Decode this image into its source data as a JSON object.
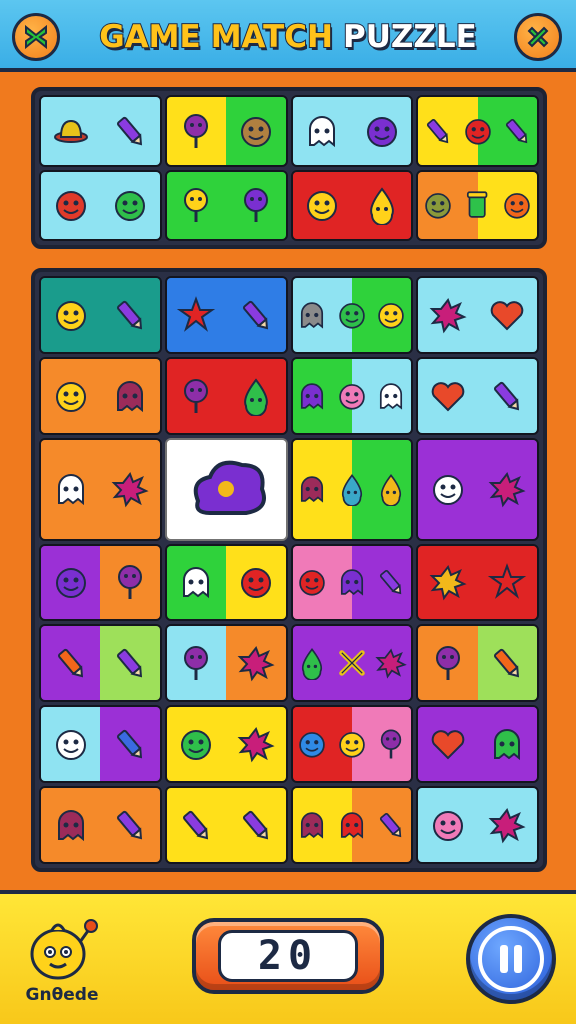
{
  "header": {
    "title_parts": [
      "GAME",
      "MATCH",
      "PUZZLE"
    ],
    "left_icon": "crossed-swords-icon",
    "right_icon": "tools-icon"
  },
  "colors": {
    "orange": "#f58a2a",
    "green": "#2fd23b",
    "blue": "#2f7de6",
    "cyan": "#8fe3f2",
    "yellow": "#ffe01a",
    "red": "#e02424",
    "purple": "#9b30d6",
    "pink": "#f07ab8",
    "lime": "#9ee05a",
    "teal": "#1a9c8c",
    "lightgreen": "#6fe05c",
    "white": "#ffffff"
  },
  "top_board": [
    {
      "bg": [
        "cyan",
        "cyan"
      ],
      "icons": [
        "hat-icon",
        "crayon-icon"
      ]
    },
    {
      "bg": [
        "yellow",
        "green"
      ],
      "icons": [
        "lollipop-icon",
        "potato-monster-icon"
      ]
    },
    {
      "bg": [
        "cyan",
        "cyan"
      ],
      "icons": [
        "ghost-blob-icon",
        "purple-blob-icon"
      ]
    },
    {
      "bg": [
        "yellow",
        "green"
      ],
      "icons": [
        "crayon-icon",
        "apple-icon",
        "crayon-icon"
      ]
    },
    {
      "bg": [
        "cyan",
        "cyan"
      ],
      "icons": [
        "ball-icon",
        "green-blob-icon"
      ]
    },
    {
      "bg": [
        "green",
        "green"
      ],
      "icons": [
        "yellow-lollipop-icon",
        "purple-lollipop-icon"
      ]
    },
    {
      "bg": [
        "red",
        "red"
      ],
      "icons": [
        "yellow-blob-icon",
        "yellow-drop-icon"
      ]
    },
    {
      "bg": [
        "orange",
        "yellow"
      ],
      "icons": [
        "olive-blob-icon",
        "cup-icon",
        "orange-blob-icon"
      ]
    }
  ],
  "main_board": [
    {
      "bg": [
        "teal",
        "teal"
      ],
      "icons": [
        "smile-icon",
        "crayon-icon"
      ]
    },
    {
      "bg": [
        "blue",
        "blue"
      ],
      "icons": [
        "star-icon",
        "crayon-icon"
      ]
    },
    {
      "bg": [
        "cyan",
        "green"
      ],
      "icons": [
        "bell-monster-icon",
        "eye-monster-icon",
        "smile-icon"
      ]
    },
    {
      "bg": [
        "cyan",
        "cyan"
      ],
      "icons": [
        "splat-icon",
        "heart-icon"
      ]
    },
    {
      "bg": [
        "orange",
        "orange"
      ],
      "icons": [
        "smile-icon",
        "robot-icon"
      ]
    },
    {
      "bg": [
        "red",
        "red"
      ],
      "icons": [
        "lollipop-icon",
        "drop-icon"
      ]
    },
    {
      "bg": [
        "green",
        "cyan"
      ],
      "icons": [
        "purple-ghost-icon",
        "pink-blob-icon",
        "ghost-icon"
      ]
    },
    {
      "bg": [
        "cyan",
        "cyan"
      ],
      "icons": [
        "heart-lollipop-icon",
        "crayon-icon"
      ]
    },
    {
      "bg": [
        "orange",
        "orange"
      ],
      "icons": [
        "doll-icon",
        "splat-icon"
      ]
    },
    {
      "bg": [
        "white",
        "white"
      ],
      "icons": [
        "cloud-blob-icon"
      ]
    },
    {
      "bg": [
        "yellow",
        "green"
      ],
      "icons": [
        "bell-robot-icon",
        "squid-icon",
        "seahorse-icon"
      ]
    },
    {
      "bg": [
        "purple",
        "purple"
      ],
      "icons": [
        "face-icon",
        "splat-icon"
      ]
    },
    {
      "bg": [
        "purple",
        "orange"
      ],
      "icons": [
        "purple-blob-icon",
        "lollipop-icon"
      ]
    },
    {
      "bg": [
        "green",
        "yellow"
      ],
      "icons": [
        "ghost-icon",
        "red-ball-icon"
      ]
    },
    {
      "bg": [
        "pink",
        "purple"
      ],
      "icons": [
        "red-ball-icon",
        "purple-ghost-icon",
        "crayon-icon"
      ]
    },
    {
      "bg": [
        "red",
        "red"
      ],
      "icons": [
        "sunflower-icon",
        "star-icon"
      ]
    },
    {
      "bg": [
        "purple",
        "lime"
      ],
      "icons": [
        "carrot-icon",
        "crayon-icon"
      ]
    },
    {
      "bg": [
        "cyan",
        "orange"
      ],
      "icons": [
        "lollipop-icon",
        "splat-icon"
      ]
    },
    {
      "bg": [
        "purple",
        "purple"
      ],
      "icons": [
        "drop-icon",
        "bow-icon",
        "splat-icon"
      ]
    },
    {
      "bg": [
        "orange",
        "lime"
      ],
      "icons": [
        "lollipop-icon",
        "carrot-icon"
      ]
    },
    {
      "bg": [
        "cyan",
        "purple"
      ],
      "icons": [
        "face-icon",
        "pen-icon"
      ]
    },
    {
      "bg": [
        "yellow",
        "yellow"
      ],
      "icons": [
        "green-blob-icon",
        "splat-icon"
      ]
    },
    {
      "bg": [
        "red",
        "pink"
      ],
      "icons": [
        "blue-blob-icon",
        "smile-icon",
        "lollipop-icon"
      ]
    },
    {
      "bg": [
        "purple",
        "purple"
      ],
      "icons": [
        "heart-icon",
        "green-ghost-icon"
      ]
    },
    {
      "bg": [
        "orange",
        "orange"
      ],
      "icons": [
        "robot-icon",
        "crayon-icon"
      ]
    },
    {
      "bg": [
        "yellow",
        "yellow"
      ],
      "icons": [
        "crayon-icon",
        "crayon-icon"
      ]
    },
    {
      "bg": [
        "yellow",
        "orange"
      ],
      "icons": [
        "bell-robot-icon",
        "red-ghost-icon",
        "crayon-icon"
      ]
    },
    {
      "bg": [
        "cyan",
        "cyan"
      ],
      "icons": [
        "pink-ball-icon",
        "splat-icon"
      ]
    }
  ],
  "footer": {
    "mascot_label": "Gnθede",
    "mascot_icon": "lemon-mascot-icon",
    "score": "20",
    "pause_icon": "pause-icon"
  }
}
